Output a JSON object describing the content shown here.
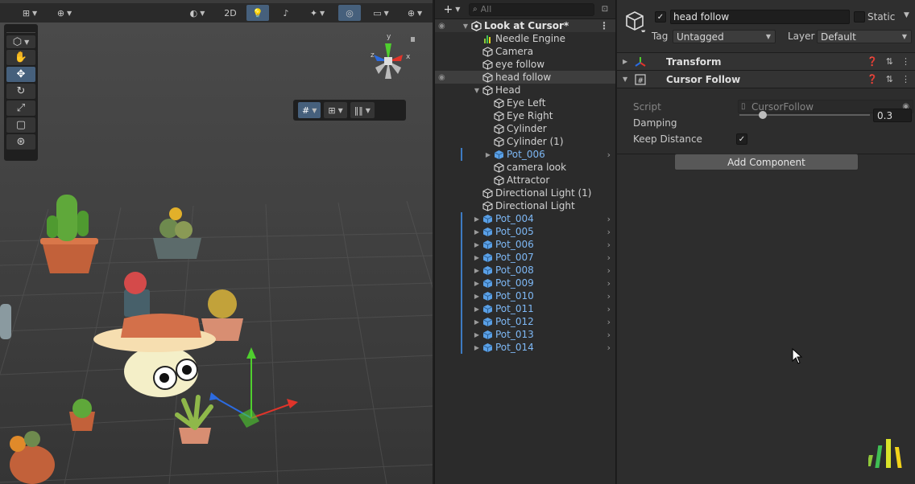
{
  "colors": {
    "accent": "#46607c",
    "prefab_text": "#7eb8f5",
    "panel_bg": "#2d2d2d",
    "scene_bg": "#3b3b3b",
    "gizmo_x": "#e0342a",
    "gizmo_y": "#4fcf2e",
    "gizmo_z": "#2c6be0"
  },
  "scene": {
    "toolbar": {
      "mode_2d": "2D",
      "icons": [
        "grid-icon",
        "globe-icon",
        "shading-icon",
        "light-bulb-icon",
        "audio-icon",
        "effects-icon",
        "visibility-icon",
        "camera-icon",
        "gizmos-icon"
      ]
    },
    "tools": [
      "view-tool",
      "move-tool",
      "rotate-tool",
      "scale-tool",
      "rect-tool",
      "transform-tool"
    ],
    "gizmo": {
      "x_label": "x",
      "y_label": "y",
      "z_label": "z"
    }
  },
  "hierarchy": {
    "search_placeholder": "All",
    "add_label": "+",
    "items": [
      {
        "label": "Look at Cursor*",
        "depth": 0,
        "arrow": "down",
        "icon": "unity-scene-icon",
        "prefab": false,
        "root": true,
        "chev": false
      },
      {
        "label": "Needle Engine",
        "depth": 1,
        "arrow": "",
        "icon": "needle-icon",
        "prefab": false,
        "chev": false
      },
      {
        "label": "Camera",
        "depth": 1,
        "arrow": "",
        "icon": "cube-icon",
        "prefab": false,
        "chev": false
      },
      {
        "label": "eye follow",
        "depth": 1,
        "arrow": "",
        "icon": "cube-icon",
        "prefab": false,
        "chev": false
      },
      {
        "label": "head follow",
        "depth": 1,
        "arrow": "",
        "icon": "cube-icon",
        "prefab": false,
        "chev": false,
        "selected": true,
        "eye": true
      },
      {
        "label": "Head",
        "depth": 1,
        "arrow": "down",
        "icon": "cube-icon",
        "prefab": false,
        "chev": false
      },
      {
        "label": "Eye Left",
        "depth": 2,
        "arrow": "",
        "icon": "cube-icon",
        "prefab": false,
        "chev": false
      },
      {
        "label": "Eye Right",
        "depth": 2,
        "arrow": "",
        "icon": "cube-icon",
        "prefab": false,
        "chev": false
      },
      {
        "label": "Cylinder",
        "depth": 2,
        "arrow": "",
        "icon": "cube-icon",
        "prefab": false,
        "chev": false
      },
      {
        "label": "Cylinder (1)",
        "depth": 2,
        "arrow": "",
        "icon": "cube-icon",
        "prefab": false,
        "chev": false
      },
      {
        "label": "Pot_006",
        "depth": 2,
        "arrow": "right",
        "icon": "prefab-icon",
        "prefab": true,
        "chev": true
      },
      {
        "label": "camera look",
        "depth": 2,
        "arrow": "",
        "icon": "cube-icon",
        "prefab": false,
        "chev": false
      },
      {
        "label": "Attractor",
        "depth": 2,
        "arrow": "",
        "icon": "cube-icon",
        "prefab": false,
        "chev": false
      },
      {
        "label": "Directional Light (1)",
        "depth": 1,
        "arrow": "",
        "icon": "cube-icon",
        "prefab": false,
        "chev": false
      },
      {
        "label": "Directional Light",
        "depth": 1,
        "arrow": "",
        "icon": "cube-icon",
        "prefab": false,
        "chev": false
      },
      {
        "label": "Pot_004",
        "depth": 1,
        "arrow": "right",
        "icon": "prefab-icon",
        "prefab": true,
        "chev": true
      },
      {
        "label": "Pot_005",
        "depth": 1,
        "arrow": "right",
        "icon": "prefab-icon",
        "prefab": true,
        "chev": true
      },
      {
        "label": "Pot_006",
        "depth": 1,
        "arrow": "right",
        "icon": "prefab-icon",
        "prefab": true,
        "chev": true
      },
      {
        "label": "Pot_007",
        "depth": 1,
        "arrow": "right",
        "icon": "prefab-icon",
        "prefab": true,
        "chev": true
      },
      {
        "label": "Pot_008",
        "depth": 1,
        "arrow": "right",
        "icon": "prefab-icon",
        "prefab": true,
        "chev": true
      },
      {
        "label": "Pot_009",
        "depth": 1,
        "arrow": "right",
        "icon": "prefab-icon",
        "prefab": true,
        "chev": true
      },
      {
        "label": "Pot_010",
        "depth": 1,
        "arrow": "right",
        "icon": "prefab-icon",
        "prefab": true,
        "chev": true
      },
      {
        "label": "Pot_011",
        "depth": 1,
        "arrow": "right",
        "icon": "prefab-icon",
        "prefab": true,
        "chev": true
      },
      {
        "label": "Pot_012",
        "depth": 1,
        "arrow": "right",
        "icon": "prefab-icon",
        "prefab": true,
        "chev": true
      },
      {
        "label": "Pot_013",
        "depth": 1,
        "arrow": "right",
        "icon": "prefab-icon",
        "prefab": true,
        "chev": true
      },
      {
        "label": "Pot_014",
        "depth": 1,
        "arrow": "right",
        "icon": "prefab-icon",
        "prefab": true,
        "chev": true
      }
    ]
  },
  "inspector": {
    "object_name": "head follow",
    "active_checked": true,
    "static_label": "Static",
    "static_checked": false,
    "tag_label": "Tag",
    "tag_value": "Untagged",
    "layer_label": "Layer",
    "layer_value": "Default",
    "components": {
      "transform": {
        "title": "Transform",
        "expanded": false
      },
      "cursor_follow": {
        "title": "Cursor Follow",
        "expanded": true,
        "script_label": "Script",
        "script_value": "CursorFollow",
        "damping_label": "Damping",
        "damping_value": "0.3",
        "damping_fraction": 0.18,
        "keep_distance_label": "Keep Distance",
        "keep_distance_checked": true
      }
    },
    "add_component_label": "Add Component"
  }
}
